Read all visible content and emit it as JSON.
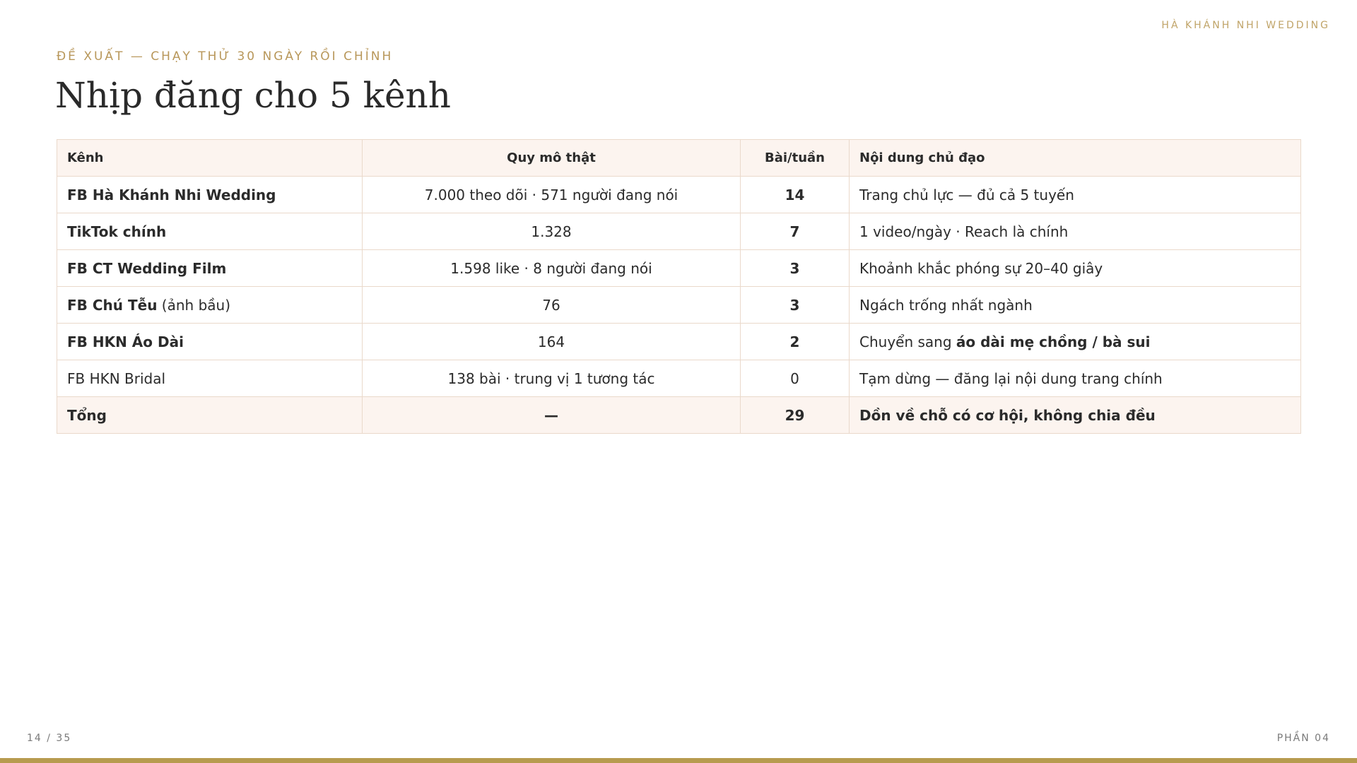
{
  "brand": "HÀ KHÁNH NHI WEDDING",
  "kicker": "ĐỀ XUẤT — CHẠY THỬ 30 NGÀY RỒI CHỈNH",
  "title": "Nhịp đăng cho 5 kênh",
  "table": {
    "headers": {
      "channel": "Kênh",
      "scale": "Quy mô thật",
      "posts": "Bài/tuần",
      "content": "Nội dung chủ đạo"
    },
    "rows": [
      {
        "channel": "FB Hà Khánh Nhi Wedding",
        "channel_note": "",
        "scale": "7.000 theo dõi · 571 người đang nói",
        "posts": "14",
        "content": "Trang chủ lực — đủ cả 5 tuyến",
        "content_bold": ""
      },
      {
        "channel": "TikTok chính",
        "channel_note": "",
        "scale": "1.328",
        "posts": "7",
        "content": "1 video/ngày · Reach là chính",
        "content_bold": ""
      },
      {
        "channel": "FB CT Wedding Film",
        "channel_note": "",
        "scale": "1.598 like · 8 người đang nói",
        "posts": "3",
        "content": "Khoảnh khắc phóng sự 20–40 giây",
        "content_bold": ""
      },
      {
        "channel": "FB Chú Tễu",
        "channel_note": "(ảnh bầu)",
        "scale": "76",
        "posts": "3",
        "content": "Ngách trống nhất ngành",
        "content_bold": ""
      },
      {
        "channel": "FB HKN Áo Dài",
        "channel_note": "",
        "scale": "164",
        "posts": "2",
        "content": "Chuyển sang ",
        "content_bold": "áo dài mẹ chồng / bà sui"
      },
      {
        "channel": "FB HKN Bridal",
        "channel_note": "",
        "scale": "138 bài · trung vị 1 tương tác",
        "posts": "0",
        "content": "Tạm dừng — đăng lại nội dung trang chính",
        "content_bold": ""
      }
    ],
    "total": {
      "channel": "Tổng",
      "scale": "—",
      "posts": "29",
      "content": "Dồn về chỗ có cơ hội, không chia đều"
    }
  },
  "footer": {
    "page": "14 / 35",
    "section": "PHẦN 04"
  },
  "colors": {
    "accent_gold": "#b79b4f",
    "header_bg": "#fcf4ef",
    "border": "#ead9cb"
  }
}
